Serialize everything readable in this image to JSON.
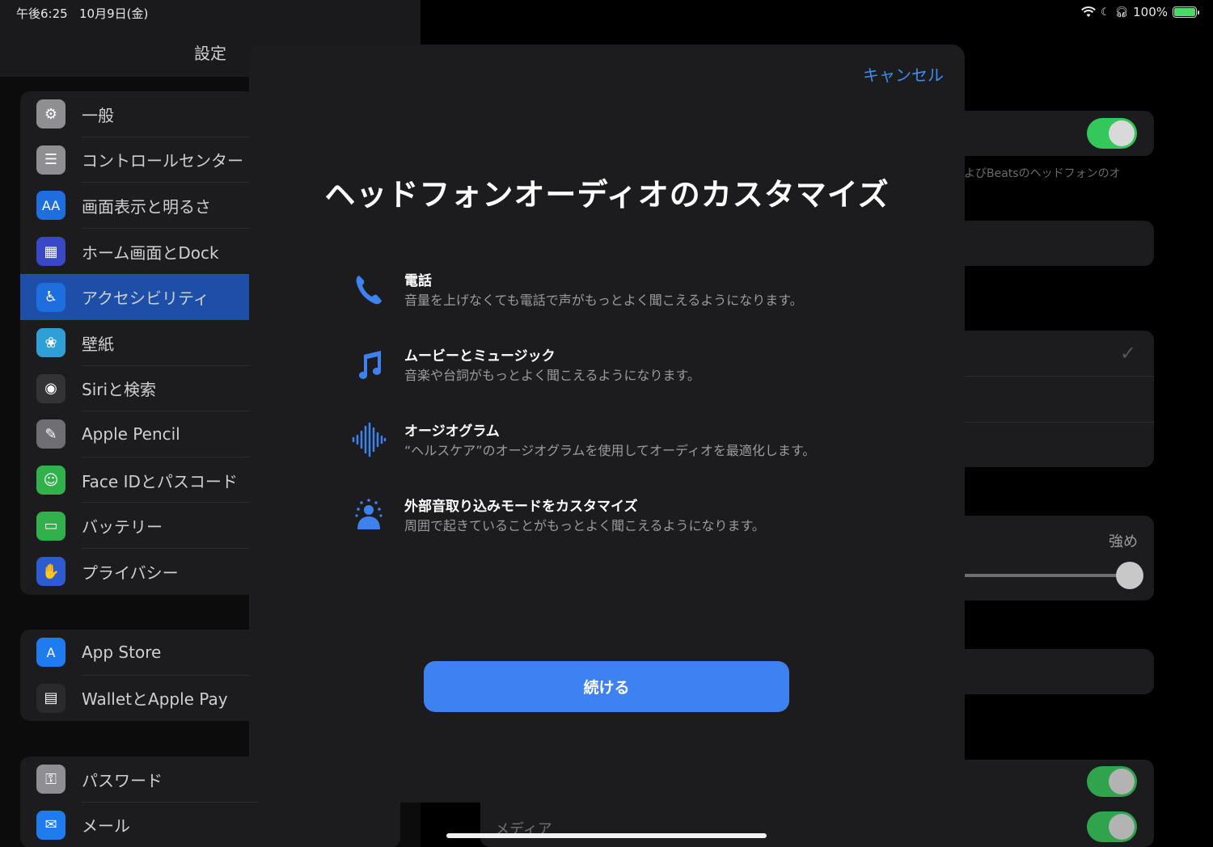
{
  "status": {
    "time": "午後6:25",
    "date": "10月9日(金)",
    "battery": "100%"
  },
  "sidebar": {
    "title": "設定",
    "group1": [
      {
        "label": "一般",
        "icon": "gear-icon",
        "color": "#8e8e93"
      },
      {
        "label": "コントロールセンター",
        "icon": "switches-icon",
        "color": "#8e8e93"
      },
      {
        "label": "画面表示と明るさ",
        "icon": "text-size-icon",
        "color": "#1d6fe0"
      },
      {
        "label": "ホーム画面とDock",
        "icon": "grid-icon",
        "color": "#3a48c8"
      },
      {
        "label": "アクセシビリティ",
        "icon": "accessibility-icon",
        "color": "#1d6fe0"
      },
      {
        "label": "壁紙",
        "icon": "flower-icon",
        "color": "#2f9fd8"
      },
      {
        "label": "Siriと検索",
        "icon": "siri-icon",
        "color": "#333336"
      },
      {
        "label": "Apple Pencil",
        "icon": "pencil-icon",
        "color": "#6e6e73"
      },
      {
        "label": "Face IDとパスコード",
        "icon": "faceid-icon",
        "color": "#30b14c"
      },
      {
        "label": "バッテリー",
        "icon": "battery-icon",
        "color": "#30b14c"
      },
      {
        "label": "プライバシー",
        "icon": "hand-icon",
        "color": "#2d5bd0"
      }
    ],
    "group2": [
      {
        "label": "App Store",
        "icon": "appstore-icon",
        "color": "#1e7cf0"
      },
      {
        "label": "WalletとApple Pay",
        "icon": "wallet-icon",
        "color": "#2a2a2c"
      }
    ],
    "group3": [
      {
        "label": "パスワード",
        "icon": "key-icon",
        "color": "#8e8e93"
      },
      {
        "label": "メール",
        "icon": "mail-icon",
        "color": "#1e7cf0"
      }
    ]
  },
  "detail": {
    "beats_text": "よびBeatsのヘッドフォンのオ",
    "slider_label": "強め",
    "media_label": "メディア"
  },
  "modal": {
    "cancel": "キャンセル",
    "title": "ヘッドフォンオーディオのカスタマイズ",
    "features": [
      {
        "icon": "phone-icon",
        "title": "電話",
        "desc": "音量を上げなくても電話で声がもっとよく聞こえるようになります。"
      },
      {
        "icon": "music-note-icon",
        "title": "ムービーとミュージック",
        "desc": "音楽や台詞がもっとよく聞こえるようになります。"
      },
      {
        "icon": "waveform-icon",
        "title": "オージオグラム",
        "desc": "“ヘルスケア”のオージオグラムを使用してオーディオを最適化します。"
      },
      {
        "icon": "transparency-icon",
        "title": "外部音取り込みモードをカスタマイズ",
        "desc": "周囲で起きていることがもっとよく聞こえるようになります。"
      }
    ],
    "continue": "続ける",
    "accent": "#3d82f0"
  }
}
